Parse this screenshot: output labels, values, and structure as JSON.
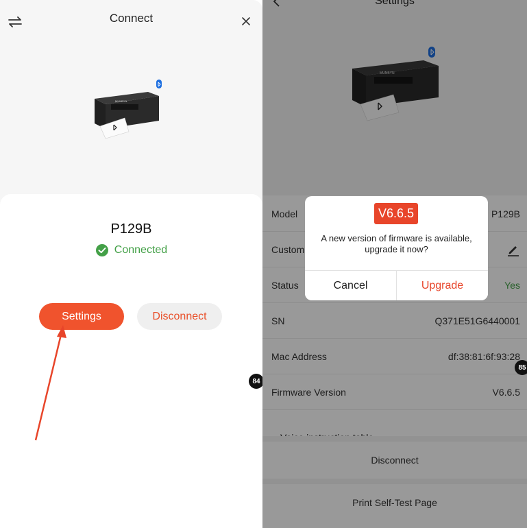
{
  "left": {
    "title": "Connect",
    "device_name": "P129B",
    "status": "Connected",
    "settings_button": "Settings",
    "disconnect_button": "Disconnect",
    "printer_brand": "MUNBYN",
    "badge": "84"
  },
  "right": {
    "title": "Settings",
    "printer_brand": "MUNBYN",
    "rows": [
      {
        "label": "Model",
        "value": "P129B"
      },
      {
        "label": "Customize Name",
        "value": ""
      },
      {
        "label": "Status",
        "value": "Yes"
      },
      {
        "label": "SN",
        "value": "Q371E51G6440001"
      },
      {
        "label": "Mac Address",
        "value": "df:38:81:6f:93:28"
      },
      {
        "label": "Firmware Version",
        "value": "V6.6.5"
      }
    ],
    "partial_row": "Voice instruction table",
    "disconnect_button": "Disconnect",
    "self_test_button": "Print Self-Test Page",
    "badge": "85"
  },
  "dialog": {
    "version": "V6.6.5",
    "message": "A new version of firmware is available, upgrade it now?",
    "cancel": "Cancel",
    "upgrade": "Upgrade"
  },
  "colors": {
    "accent": "#f0532d",
    "success": "#43a047",
    "overlay": "rgba(0,0,0,0.40)"
  }
}
